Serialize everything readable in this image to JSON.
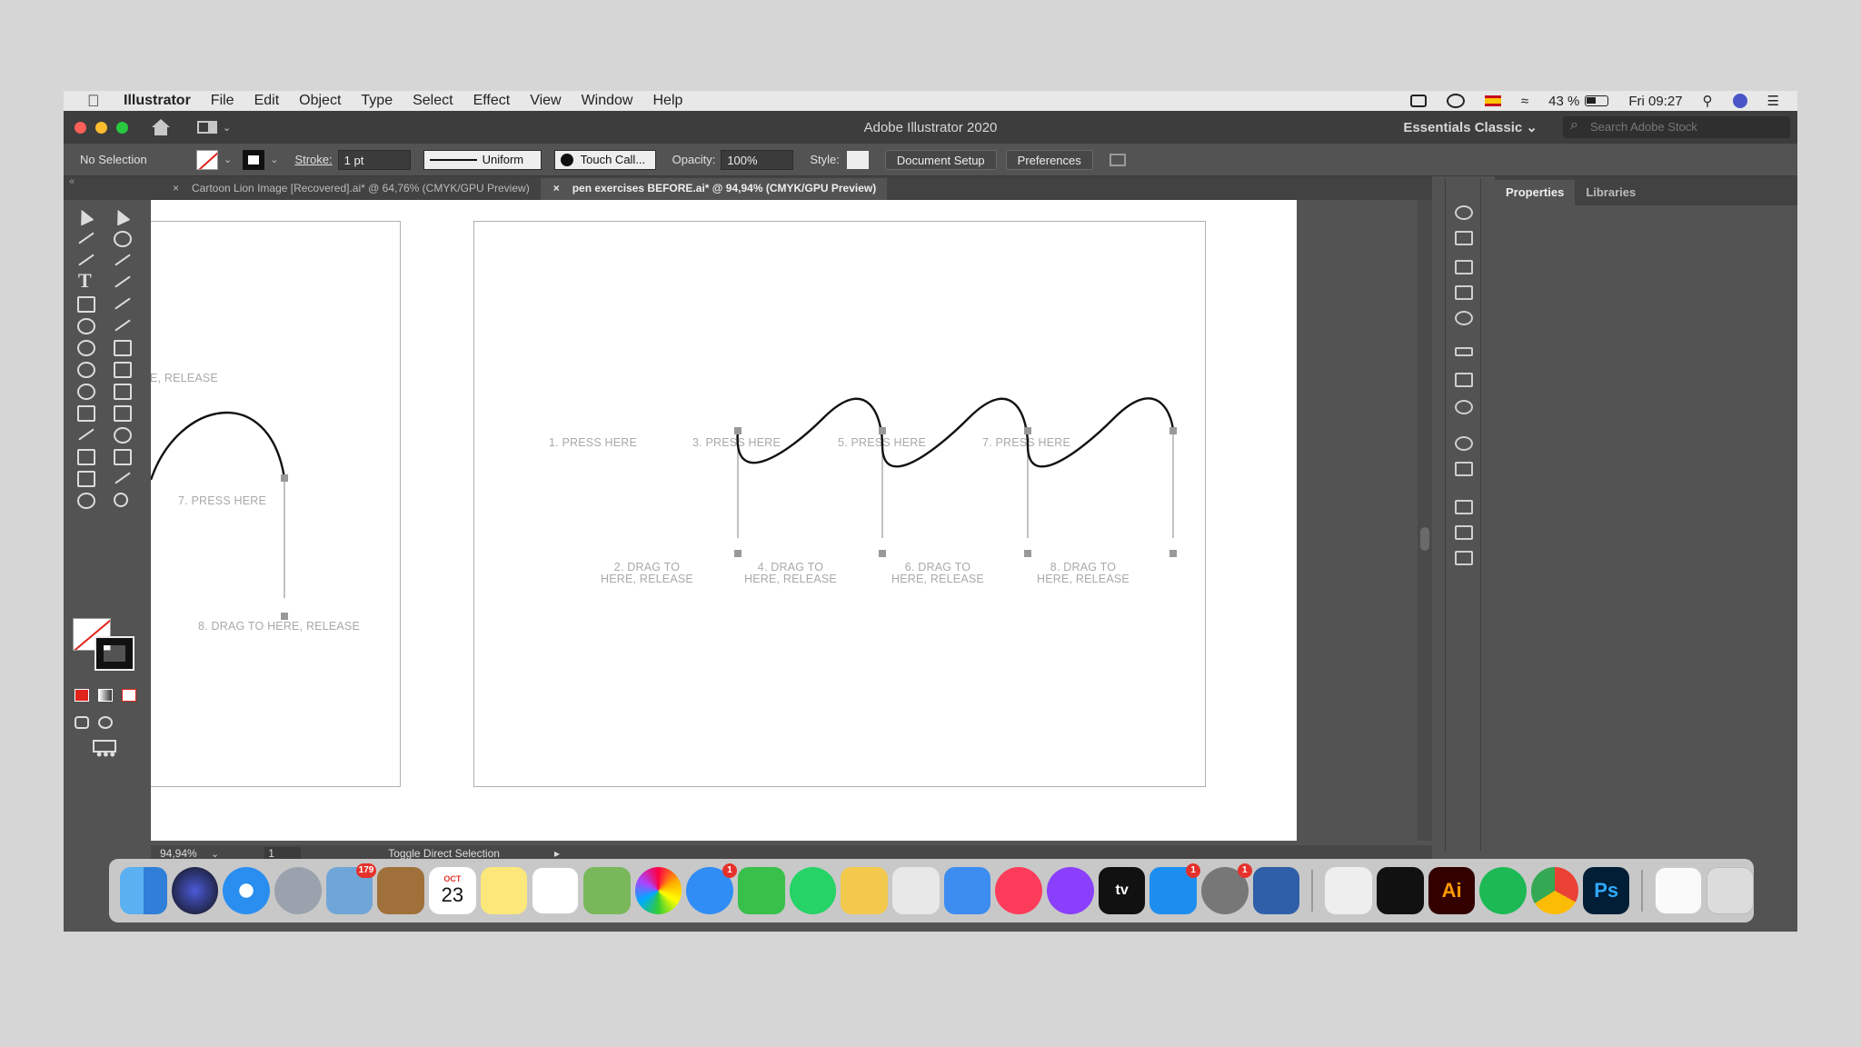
{
  "menubar": {
    "app_name": "Illustrator",
    "menus": [
      "File",
      "Edit",
      "Object",
      "Type",
      "Select",
      "Effect",
      "View",
      "Window",
      "Help"
    ],
    "battery": "43 %",
    "clock": "Fri 09:27"
  },
  "titlebar": {
    "title": "Adobe Illustrator 2020",
    "workspace": "Essentials Classic",
    "search_placeholder": "Search Adobe Stock"
  },
  "controlbar": {
    "selection": "No Selection",
    "stroke_label": "Stroke:",
    "stroke_weight": "1 pt",
    "profile": "Uniform",
    "brush": "Touch Call...",
    "opacity_label": "Opacity:",
    "opacity": "100%",
    "style_label": "Style:",
    "document_setup": "Document Setup",
    "preferences": "Preferences"
  },
  "tabs": [
    {
      "label": "Cartoon Lion Image [Recovered].ai* @ 64,76% (CMYK/GPU Preview)",
      "active": false
    },
    {
      "label": "pen exercises BEFORE.ai* @ 94,94% (CMYK/GPU Preview)",
      "active": true
    }
  ],
  "canvas": {
    "left_artboard": {
      "release_partial": "E, RELEASE",
      "press": "7. PRESS HERE",
      "drag": "8. DRAG TO HERE, RELEASE"
    },
    "main_artboard": {
      "press": [
        "1. PRESS HERE",
        "3. PRESS HERE",
        "5. PRESS HERE",
        "7. PRESS HERE"
      ],
      "drag_line1": [
        "2. DRAG TO",
        "4. DRAG TO",
        "6. DRAG TO",
        "8. DRAG TO"
      ],
      "drag_line2": [
        "HERE, RELEASE",
        "HERE, RELEASE",
        "HERE, RELEASE",
        "HERE, RELEASE"
      ]
    }
  },
  "statusbar": {
    "zoom": "94,94%",
    "page": "1",
    "status": "Toggle Direct Selection"
  },
  "panel": {
    "tabs": [
      "Properties",
      "Libraries"
    ]
  },
  "dock": {
    "calendar_month": "OCT",
    "calendar_day": "23",
    "mail_badge": "179",
    "messages_badge": "1",
    "appstore_badge": "1",
    "prefs_badge": "1",
    "ai_label": "Ai",
    "ps_label": "Ps",
    "tv_label": "tv"
  },
  "colors": {
    "ui_dark": "#535353",
    "ai_orange": "#ff9a00",
    "ps_blue": "#31a8ff",
    "close_red": "#fe5f57"
  }
}
